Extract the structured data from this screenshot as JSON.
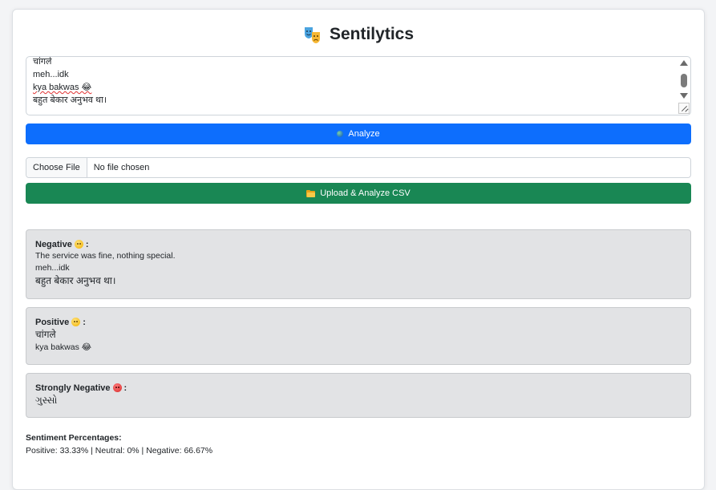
{
  "app": {
    "title": "Sentilytics",
    "logo_icon": "theater-masks-icon"
  },
  "input": {
    "lines": [
      "चांगले",
      "meh...idk",
      "kya bakwas 😂",
      "बहुत बेकार अनुभव था।"
    ]
  },
  "buttons": {
    "analyze_label": "Analyze",
    "analyze_icon": "globe-icon",
    "upload_label": "Upload & Analyze CSV",
    "upload_icon": "folder-icon",
    "analyze_color": "#0d6efd",
    "upload_color": "#198754"
  },
  "file_input": {
    "button_label": "Choose File",
    "status": "No file chosen"
  },
  "results": [
    {
      "label": "Negative",
      "emoji": "neutral-face-icon",
      "items": [
        "The service was fine, nothing special.",
        "meh...idk",
        "बहुत बेकार अनुभव था।"
      ]
    },
    {
      "label": "Positive",
      "emoji": "smile-face-icon",
      "items": [
        "चांगले",
        "kya bakwas 😂"
      ]
    },
    {
      "label": "Strongly Negative",
      "emoji": "angry-face-icon",
      "items": [
        "ગુસ્સો"
      ]
    }
  ],
  "percentages": {
    "title": "Sentiment Percentages:",
    "values_text": "Positive: 33.33% | Neutral: 0% | Negative: 66.67%",
    "positive": 33.33,
    "neutral": 0,
    "negative": 66.67
  }
}
